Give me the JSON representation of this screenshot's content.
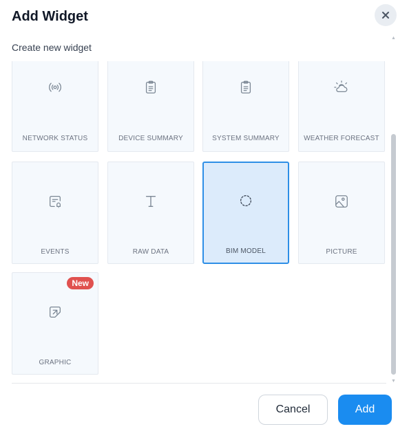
{
  "dialog": {
    "title": "Add Widget",
    "subtitle": "Create new widget",
    "close_icon": "close-icon"
  },
  "widgets": [
    {
      "label": "NETWORK STATUS",
      "icon": "broadcast-icon",
      "selected": false,
      "badge": ""
    },
    {
      "label": "DEVICE SUMMARY",
      "icon": "clipboard-icon",
      "selected": false,
      "badge": ""
    },
    {
      "label": "SYSTEM SUMMARY",
      "icon": "clipboard-icon",
      "selected": false,
      "badge": ""
    },
    {
      "label": "WEATHER FORECAST",
      "icon": "sun-cloud-icon",
      "selected": false,
      "badge": ""
    },
    {
      "label": "EVENTS",
      "icon": "event-bell-icon",
      "selected": false,
      "badge": ""
    },
    {
      "label": "RAW DATA",
      "icon": "text-icon",
      "selected": false,
      "badge": ""
    },
    {
      "label": "BIM MODEL",
      "icon": "3d-cube-icon",
      "selected": true,
      "badge": ""
    },
    {
      "label": "PICTURE",
      "icon": "image-icon",
      "selected": false,
      "badge": ""
    },
    {
      "label": "GRAPHIC",
      "icon": "graphic-icon",
      "selected": false,
      "badge": "New"
    }
  ],
  "footer": {
    "cancel_label": "Cancel",
    "add_label": "Add"
  },
  "colors": {
    "accent": "#1a8cf0",
    "selected_bg": "#dcebfb",
    "badge": "#e0514f"
  }
}
